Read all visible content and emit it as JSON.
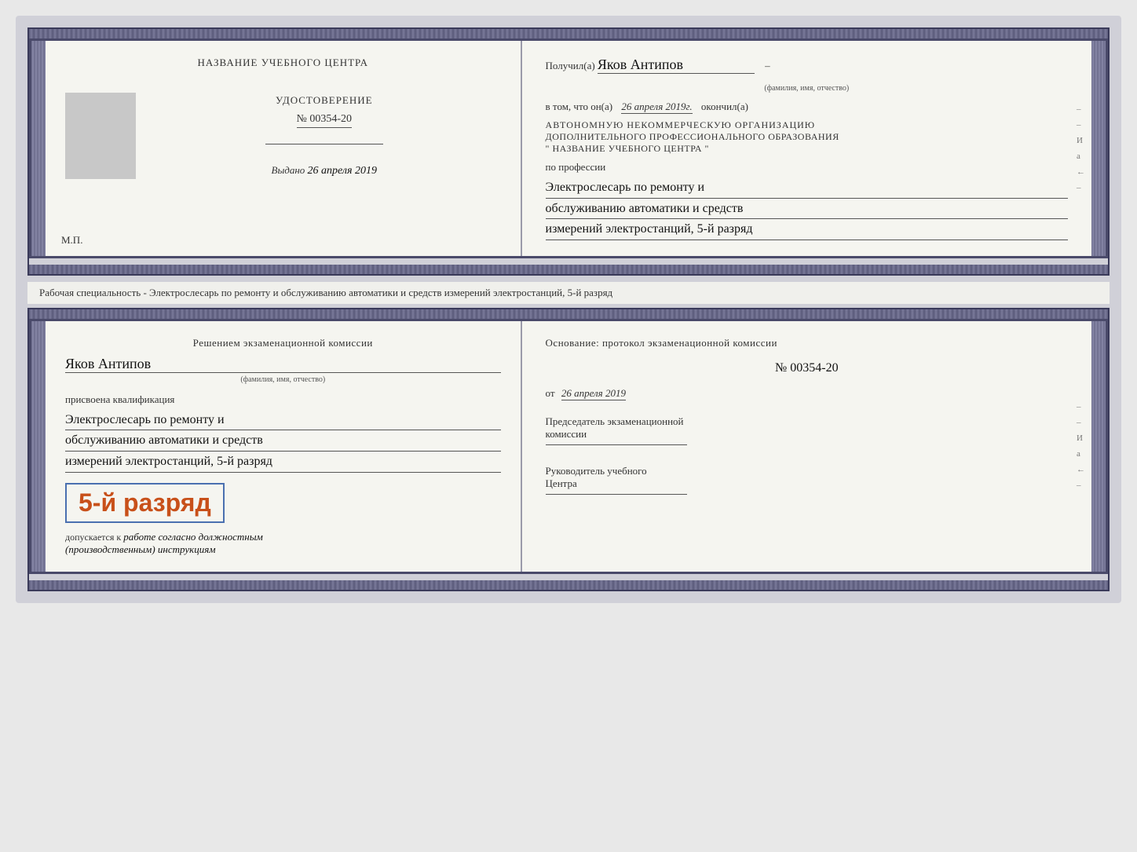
{
  "top_doc": {
    "left": {
      "header": "НАЗВАНИЕ УЧЕБНОГО ЦЕНТРА",
      "cert_title": "УДОСТОВЕРЕНИЕ",
      "cert_number": "№ 00354-20",
      "issued_label": "Выдано",
      "issued_date": "26 апреля 2019",
      "mp_label": "М.П."
    },
    "right": {
      "received_label": "Получил(а)",
      "recipient_name": "Яков Антипов",
      "name_sublabel": "(фамилия, имя, отчество)",
      "confirm_text": "в том, что он(а)",
      "confirm_date": "26 апреля 2019г.",
      "confirm_end": "окончил(а)",
      "org_line1": "АВТОНОМНУЮ НЕКОММЕРЧЕСКУЮ ОРГАНИЗАЦИЮ",
      "org_line2": "ДОПОЛНИТЕЛЬНОГО ПРОФЕССИОНАЛЬНОГО ОБРАЗОВАНИЯ",
      "org_line3": "\"   НАЗВАНИЕ УЧЕБНОГО ЦЕНТРА   \"",
      "profession_label": "по профессии",
      "profession_line1": "Электрослесарь по ремонту и",
      "profession_line2": "обслуживанию автоматики и средств",
      "profession_line3": "измерений электростанций, 5-й разряд",
      "side_letters": [
        "И",
        "а",
        "←",
        "–",
        "–",
        "–",
        "–"
      ]
    }
  },
  "middle_text": "Рабочая специальность - Электрослесарь по ремонту и обслуживанию автоматики и средств\nизмерений электростанций, 5-й разряд",
  "bottom_doc": {
    "left": {
      "commission_text": "Решением экзаменационной комиссии",
      "person_name": "Яков Антипов",
      "name_sublabel": "(фамилия, имя, отчество)",
      "qualification_label": "присвоена квалификация",
      "qual_line1": "Электрослесарь по ремонту и",
      "qual_line2": "обслуживанию автоматики и средств",
      "qual_line3": "измерений электростанций, 5-й разряд",
      "rank_big": "5-й разряд",
      "допускается_text": "допускается к",
      "work_permission": "работе согласно должностным",
      "instructions": "(производственным) инструкциям"
    },
    "right": {
      "foundation_label": "Основание: протокол экзаменационной комиссии",
      "protocol_number": "№  00354-20",
      "date_label": "от",
      "date_value": "26 апреля 2019",
      "chairman_title": "Председатель экзаменационной\nкомиссии",
      "director_title": "Руководитель учебного\nЦентра",
      "side_letters": [
        "И",
        "а",
        "←",
        "–",
        "–",
        "–",
        "–"
      ]
    }
  }
}
